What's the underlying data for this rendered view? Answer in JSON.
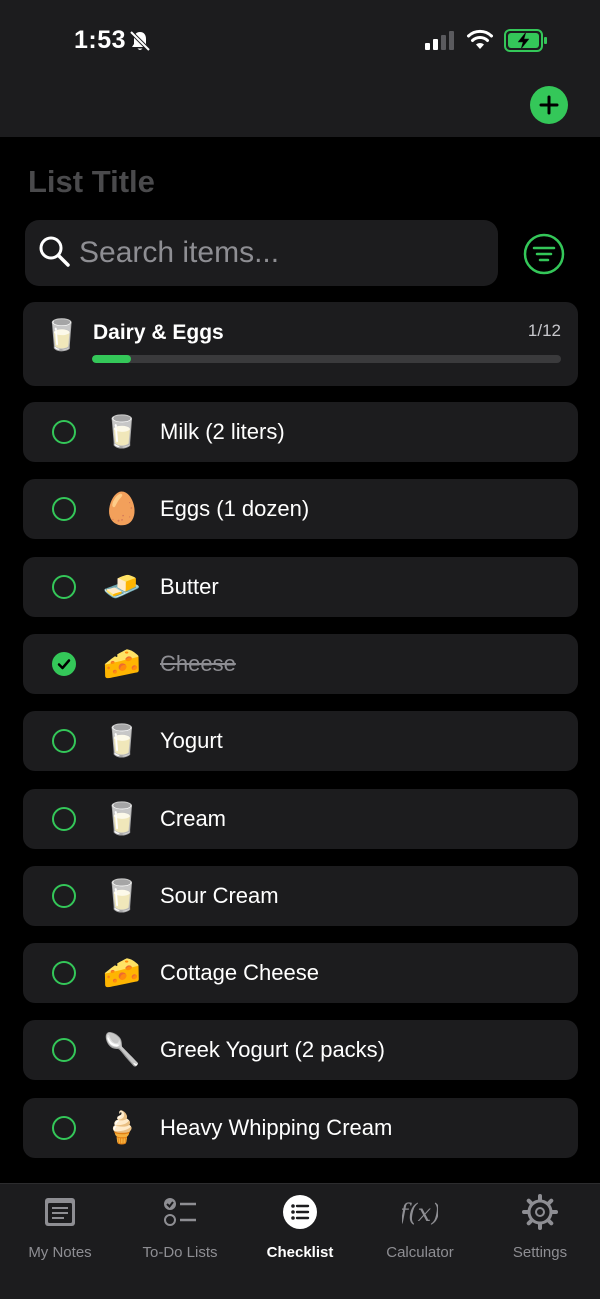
{
  "status_bar": {
    "time": "1:53"
  },
  "header": {
    "list_title": "List Title"
  },
  "search": {
    "placeholder": "Search items..."
  },
  "category": {
    "name": "Dairy & Eggs",
    "count": "1/12",
    "progress": 0.0833,
    "icon": "🥛"
  },
  "items": [
    {
      "label": "Milk (2 liters)",
      "icon": "🥛",
      "checked": false
    },
    {
      "label": "Eggs (1 dozen)",
      "icon": "🥚",
      "checked": false
    },
    {
      "label": "Butter",
      "icon": "🧈",
      "checked": false
    },
    {
      "label": "Cheese",
      "icon": "🧀",
      "checked": true
    },
    {
      "label": "Yogurt",
      "icon": "🥛",
      "checked": false
    },
    {
      "label": "Cream",
      "icon": "🥛",
      "checked": false
    },
    {
      "label": "Sour Cream",
      "icon": "🥛",
      "checked": false
    },
    {
      "label": "Cottage Cheese",
      "icon": "🧀",
      "checked": false
    },
    {
      "label": "Greek Yogurt (2 packs)",
      "icon": "🥄",
      "checked": false
    },
    {
      "label": "Heavy Whipping Cream",
      "icon": "🍦",
      "checked": false
    }
  ],
  "tabs": [
    {
      "label": "My Notes",
      "icon": "notes-icon",
      "active": false
    },
    {
      "label": "To-Do Lists",
      "icon": "todo-list-icon",
      "active": false
    },
    {
      "label": "Checklist",
      "icon": "checklist-icon",
      "active": true
    },
    {
      "label": "Calculator",
      "icon": "function-icon",
      "active": false
    },
    {
      "label": "Settings",
      "icon": "gear-icon",
      "active": false
    }
  ],
  "colors": {
    "accent": "#34c759",
    "background": "#000000",
    "card": "#1c1c1e"
  }
}
